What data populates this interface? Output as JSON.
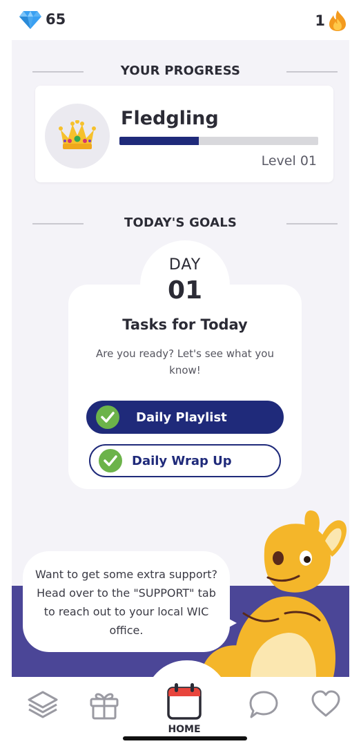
{
  "status": {
    "gems": "65",
    "streak": "1",
    "gem_icon": "diamond-icon",
    "streak_icon": "flame-icon"
  },
  "progress": {
    "section_title": "YOUR PROGRESS",
    "level_name": "Fledgling",
    "level_label": "Level 01",
    "progress_fraction": 0.4,
    "badge_icon": "crown-icon"
  },
  "goals": {
    "section_title": "TODAY'S GOALS",
    "day_label": "DAY",
    "day_number": "01",
    "title": "Tasks for Today",
    "subtitle": "Are you ready? Let's see what you know!",
    "tasks": [
      {
        "label": "Daily Playlist",
        "done": true
      },
      {
        "label": "Daily Wrap Up",
        "done": true
      }
    ]
  },
  "support": {
    "message": "Want to get some extra support? Head over to the \"SUPPORT\" tab to reach out to your local WIC office."
  },
  "nav": {
    "items": [
      {
        "icon": "layers-icon"
      },
      {
        "icon": "gift-icon"
      },
      {
        "icon": "calendar-icon",
        "label": "HOME",
        "active": true
      },
      {
        "icon": "chat-icon"
      },
      {
        "icon": "heart-icon"
      }
    ],
    "home_label": "HOME"
  },
  "colors": {
    "navy": "#1f2a7a",
    "green_check": "#6cb34a",
    "purple_band": "#4b4697",
    "kangaroo": "#f4b62a"
  }
}
